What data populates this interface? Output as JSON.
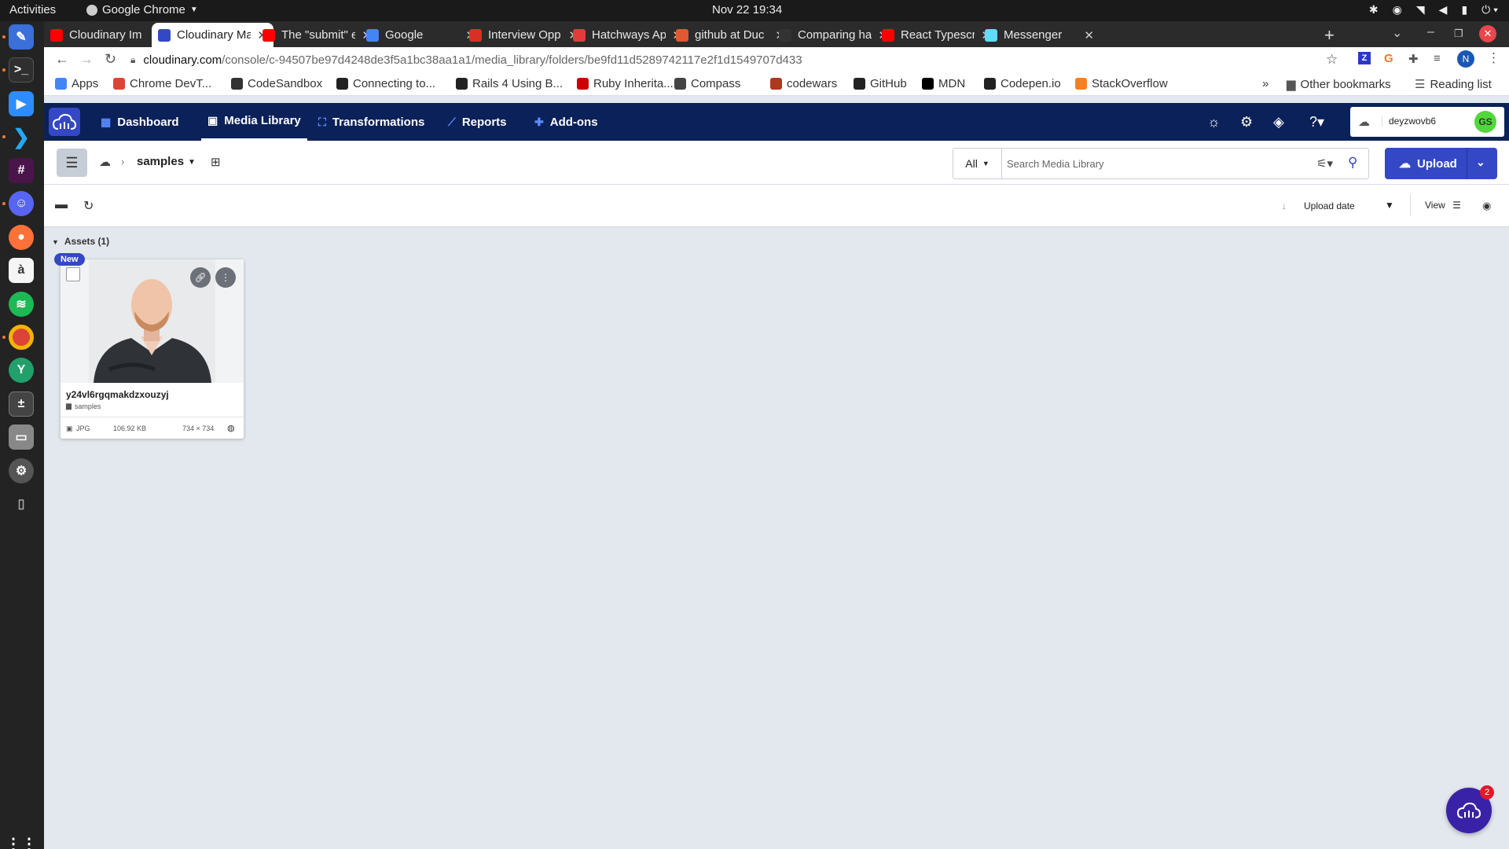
{
  "gnome": {
    "activities": "Activities",
    "app_name": "Google Chrome",
    "clock": "Nov 22  19:34"
  },
  "dock": {
    "apps": [
      "text-editor",
      "terminal",
      "zoom",
      "vscode",
      "slack",
      "discord",
      "firefox",
      "dictionary",
      "spotify",
      "chrome",
      "yarn",
      "calculator",
      "files",
      "settings",
      "usb-drive"
    ],
    "show_apps": "show-applications"
  },
  "tabs": [
    {
      "title": "Cloudinary Im",
      "favicon": "youtube",
      "color": "#ff0000",
      "active": false
    },
    {
      "title": "Cloudinary Ma",
      "favicon": "cloudinary",
      "color": "#3448c5",
      "active": true
    },
    {
      "title": "The \"submit\" e",
      "favicon": "youtube",
      "color": "#ff0000",
      "active": false
    },
    {
      "title": "Google",
      "favicon": "google",
      "color": "#4285f4",
      "active": false
    },
    {
      "title": "Interview Opp",
      "favicon": "gmail",
      "color": "#d93025",
      "active": false
    },
    {
      "title": "Hatchways Ap",
      "favicon": "hatchways",
      "color": "#e23b3b",
      "active": false
    },
    {
      "title": "github at Duc",
      "favicon": "duckduckgo",
      "color": "#de5833",
      "active": false
    },
    {
      "title": "Comparing ha",
      "favicon": "github",
      "color": "#333333",
      "active": false
    },
    {
      "title": "React Typescr",
      "favicon": "youtube",
      "color": "#ff0000",
      "active": false
    },
    {
      "title": "Messenger",
      "favicon": "react",
      "color": "#61dafb",
      "active": false
    }
  ],
  "url": {
    "host": "cloudinary.com",
    "path": "/console/c-94507be97d4248de3f5a1bc38aa1a1/media_library/folders/be9fd11d5289742117e2f1d1549707d433"
  },
  "profile_initial": "N",
  "bookmarks": [
    {
      "label": "Apps",
      "icon": "apps-grid",
      "color": "#4285f4"
    },
    {
      "label": "Chrome DevT...",
      "icon": "chrome",
      "color": "#db4437"
    },
    {
      "label": "CodeSandbox",
      "icon": "codesandbox",
      "color": "#333333"
    },
    {
      "label": "Connecting to...",
      "icon": "github",
      "color": "#222222"
    },
    {
      "label": "Rails 4 Using B...",
      "icon": "github",
      "color": "#222222"
    },
    {
      "label": "Ruby Inherita...",
      "icon": "ruby",
      "color": "#cc0000"
    },
    {
      "label": "Compass",
      "icon": "compass",
      "color": "#444444"
    },
    {
      "label": "codewars",
      "icon": "codewars",
      "color": "#b1361e"
    },
    {
      "label": "GitHub",
      "icon": "github",
      "color": "#222222"
    },
    {
      "label": "MDN",
      "icon": "mdn",
      "color": "#000000"
    },
    {
      "label": "Codepen.io",
      "icon": "codepen",
      "color": "#222222"
    },
    {
      "label": "StackOverflow",
      "icon": "stackoverflow",
      "color": "#f48024"
    }
  ],
  "bookmarks_right": {
    "other": "Other bookmarks",
    "reading": "Reading list"
  },
  "cl_nav": {
    "items": [
      {
        "label": "Dashboard",
        "icon": "dashboard-icon",
        "active": false
      },
      {
        "label": "Media Library",
        "icon": "media-library-icon",
        "active": true
      },
      {
        "label": "Transformations",
        "icon": "transformations-icon",
        "active": false
      },
      {
        "label": "Reports",
        "icon": "reports-icon",
        "active": false
      },
      {
        "label": "Add-ons",
        "icon": "addons-icon",
        "active": false
      }
    ],
    "account_name": "deyzwovb6",
    "avatar_initials": "GS"
  },
  "crumbs": {
    "folder": "samples"
  },
  "search": {
    "scope": "All",
    "placeholder": "Search Media Library"
  },
  "upload_label": "Upload",
  "actions": {
    "sort_label": "Upload date",
    "view_label": "View"
  },
  "assets": {
    "header": "Assets (1)",
    "items": [
      {
        "badge": "New",
        "name": "y24vl6rgqmakdzxouzyj",
        "folder": "samples",
        "format": "JPG",
        "size": "106.92 KB",
        "dimensions": "734 × 734"
      }
    ]
  },
  "chat_badge": "2",
  "colors": {
    "cl_nav_bg": "#0b2159",
    "accent": "#3448c5",
    "content_bg": "#e3e8ee"
  }
}
